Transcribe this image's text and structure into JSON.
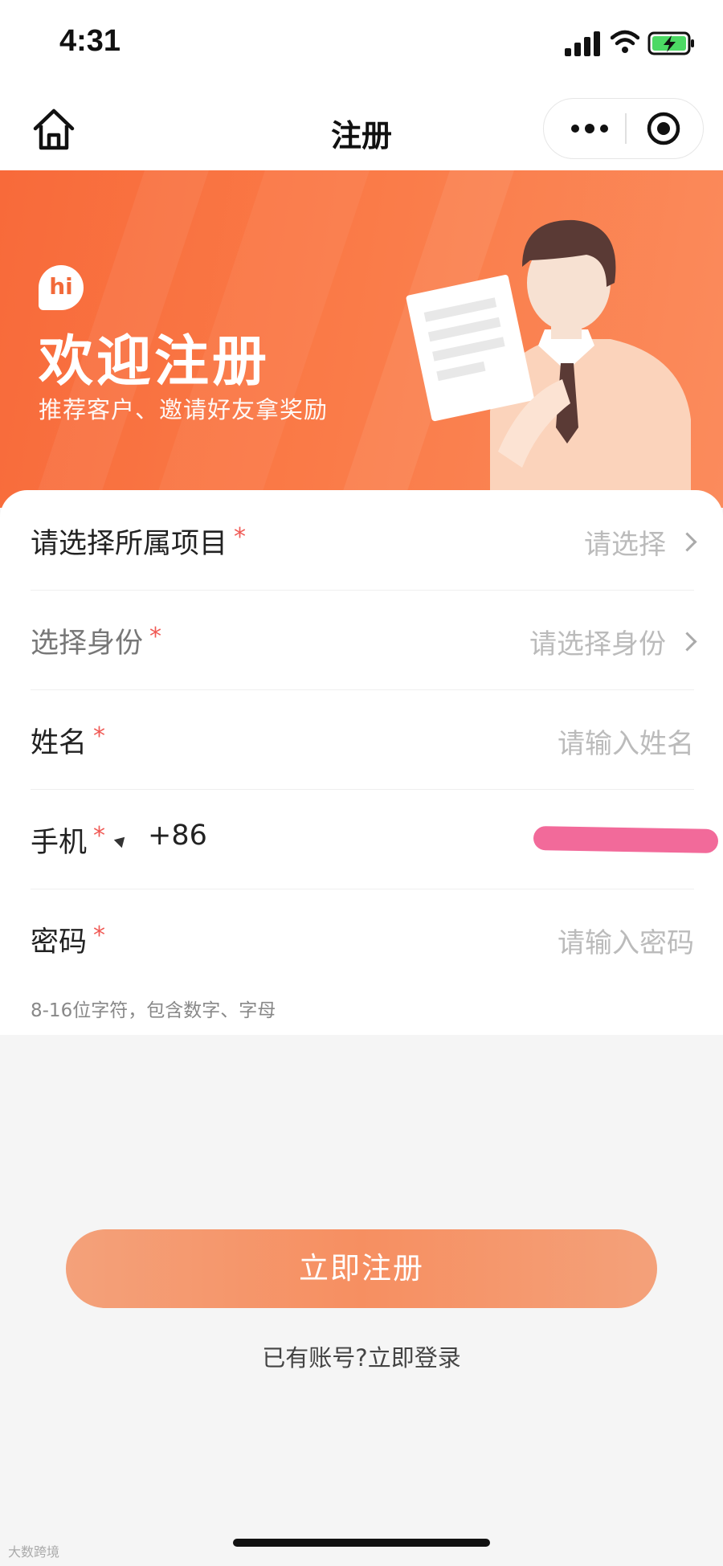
{
  "status_bar": {
    "time": "4:31"
  },
  "nav": {
    "title": "注册"
  },
  "banner": {
    "badge": "hi",
    "title": "欢迎注册",
    "subtitle": "推荐客户、邀请好友拿奖励"
  },
  "form": {
    "project": {
      "label": "请选择所属项目",
      "required": "*",
      "placeholder": "请选择"
    },
    "identity": {
      "label": "选择身份",
      "required": "*",
      "placeholder": "请选择身份"
    },
    "name": {
      "label": "姓名",
      "required": "*",
      "placeholder": "请输入姓名"
    },
    "phone": {
      "label": "手机",
      "required": "*",
      "country_code": "+86"
    },
    "password": {
      "label": "密码",
      "required": "*",
      "placeholder": "请输入密码",
      "hint": "8-16位字符，包含数字、字母"
    }
  },
  "actions": {
    "submit_label": "立即注册",
    "login_link": "已有账号?立即登录"
  },
  "watermark": "大数跨境",
  "colors": {
    "accent": "#f86a3a",
    "required": "#f05a55",
    "button": "#f68f61"
  }
}
